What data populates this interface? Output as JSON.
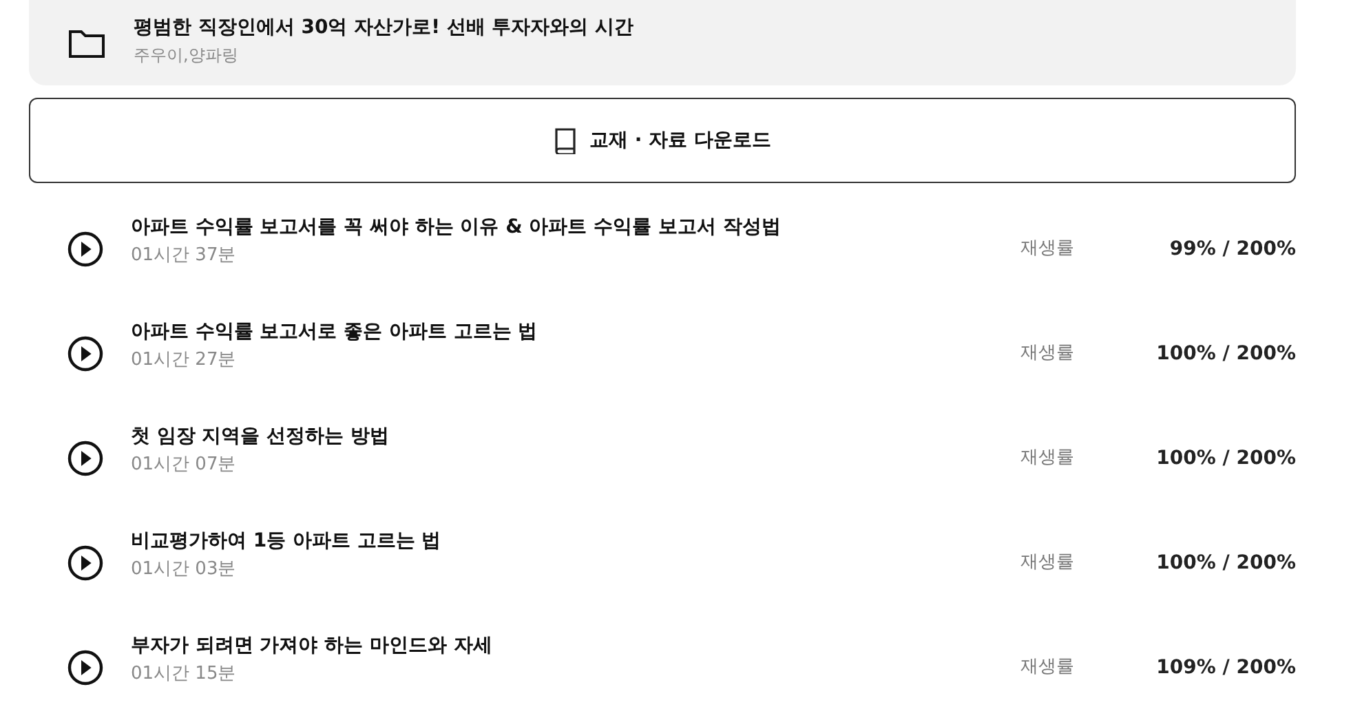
{
  "course": {
    "title": "평범한 직장인에서 30억 자산가로! 선배 투자자와의 시간",
    "instructors": "주우이,양파링"
  },
  "download_button": {
    "label": "교재 · 자료 다운로드"
  },
  "lessons": [
    {
      "title": "아파트 수익률 보고서를 꼭 써야 하는 이유 & 아파트 수익률 보고서 작성법",
      "duration": "01시간 37분",
      "rate_label": "재생률",
      "rate": "99% / 200%"
    },
    {
      "title": "아파트 수익률 보고서로 좋은 아파트 고르는 법",
      "duration": "01시간 27분",
      "rate_label": "재생률",
      "rate": "100% / 200%"
    },
    {
      "title": "첫 임장 지역을 선정하는 방법",
      "duration": "01시간 07분",
      "rate_label": "재생률",
      "rate": "100% / 200%"
    },
    {
      "title": "비교평가하여 1등 아파트 고르는 법",
      "duration": "01시간 03분",
      "rate_label": "재생률",
      "rate": "100% / 200%"
    },
    {
      "title": "부자가 되려면 가져야 하는 마인드와 자세",
      "duration": "01시간 15분",
      "rate_label": "재생률",
      "rate": "109% / 200%"
    }
  ]
}
